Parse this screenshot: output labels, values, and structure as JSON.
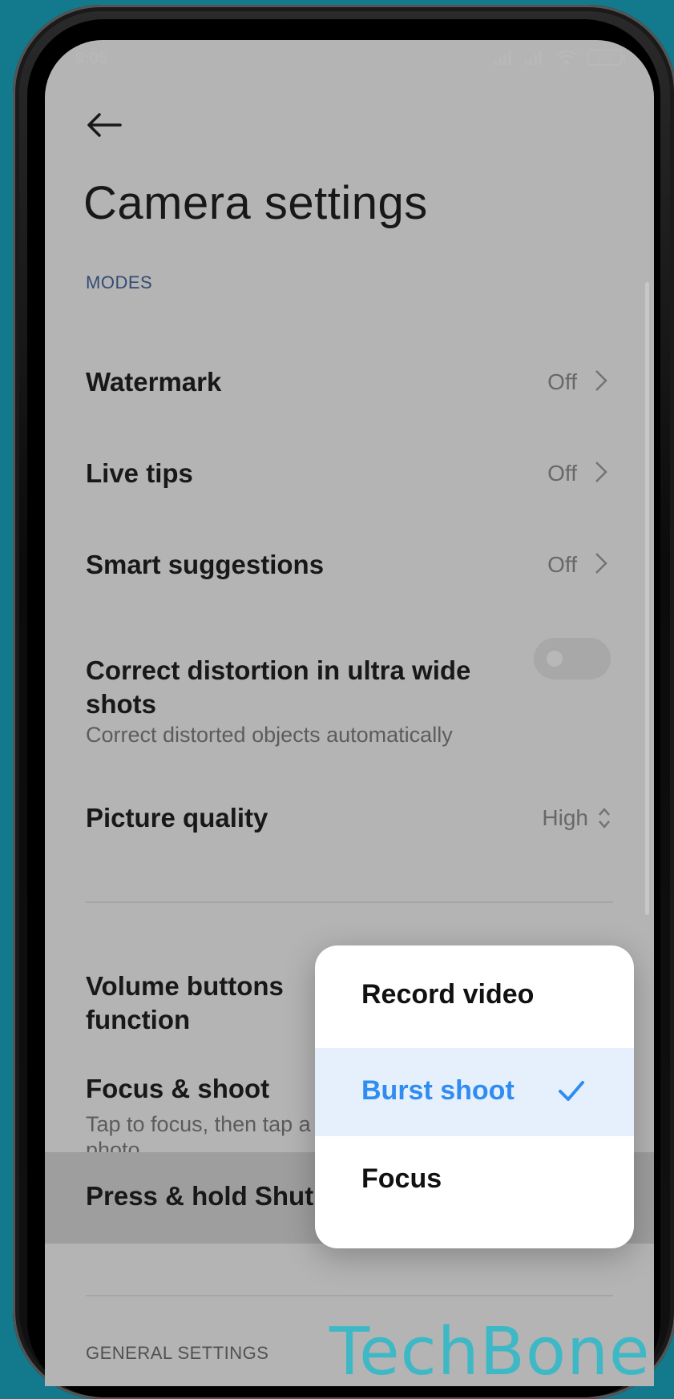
{
  "status_bar": {
    "time": "9:05",
    "battery": "100"
  },
  "header": {
    "title": "Camera settings"
  },
  "sections": {
    "modes_label": "MODES",
    "general_label": "GENERAL SETTINGS"
  },
  "rows": {
    "watermark": {
      "label": "Watermark",
      "value": "Off"
    },
    "live_tips": {
      "label": "Live tips",
      "value": "Off"
    },
    "smart_suggestions": {
      "label": "Smart suggestions",
      "value": "Off"
    },
    "correct_distortion": {
      "label": "Correct distortion in ultra wide shots",
      "subtitle": "Correct distorted objects automatically",
      "enabled": false
    },
    "picture_quality": {
      "label": "Picture quality",
      "value": "High"
    },
    "volume_buttons": {
      "label": "Volume buttons function"
    },
    "focus_shoot": {
      "label": "Focus & shoot",
      "subtitle": "Tap to focus, then tap a",
      "subtitle_line2": "photo."
    },
    "press_hold": {
      "label": "Press & hold Shut"
    }
  },
  "popup": {
    "options": [
      {
        "label": "Record video",
        "selected": false
      },
      {
        "label": "Burst shoot",
        "selected": true
      },
      {
        "label": "Focus",
        "selected": false
      }
    ]
  },
  "watermark_text": "TechBone",
  "colors": {
    "accent": "#2f8cf0",
    "background": "#13798c",
    "section": "#3b5b98"
  }
}
